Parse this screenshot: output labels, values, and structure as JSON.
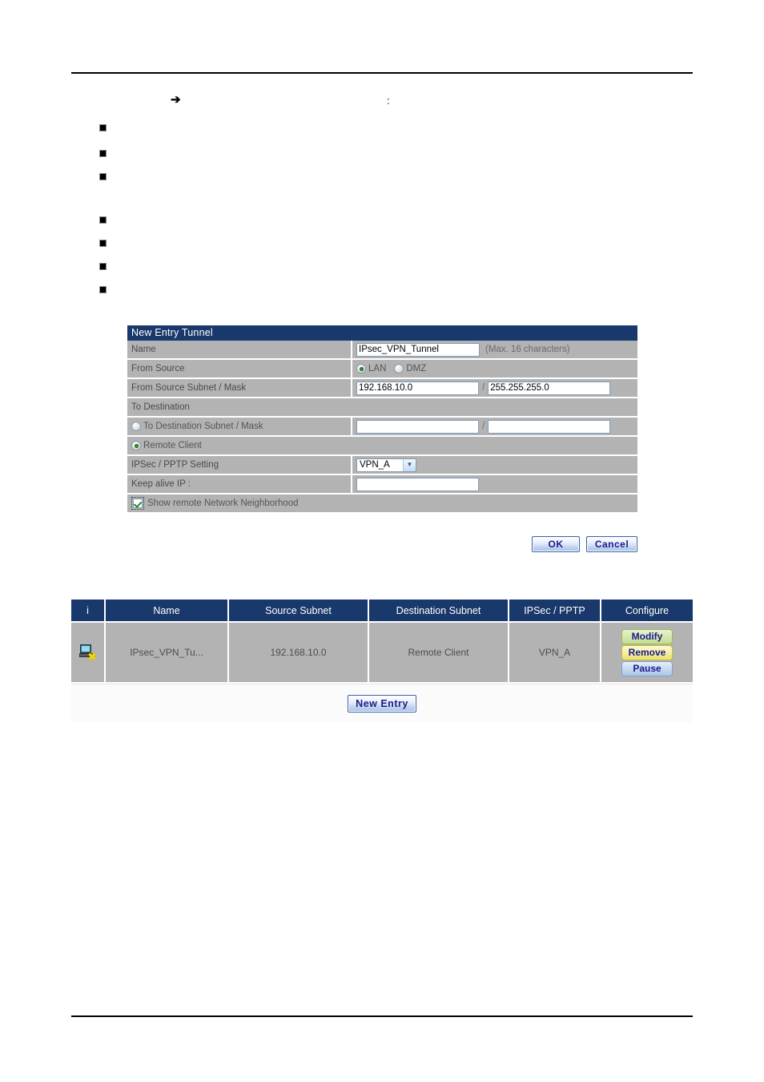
{
  "intro": {
    "arrow_marker": "➔",
    "colon_marker": ":",
    "bullets": [
      "",
      "",
      "",
      "",
      "",
      "",
      ""
    ]
  },
  "form": {
    "title": "New Entry Tunnel",
    "rows": {
      "name_label": "Name",
      "name_value": "IPsec_VPN_Tunnel",
      "name_hint": "(Max. 16 characters)",
      "from_source_label": "From Source",
      "from_source_options": [
        "LAN",
        "DMZ"
      ],
      "from_source_selected": "LAN",
      "from_subnet_label": "From Source Subnet / Mask",
      "from_subnet_value": "192.168.10.0",
      "from_mask_value": "255.255.255.0",
      "to_destination_label": "To Destination",
      "to_dest_subnet_label": "To Destination Subnet / Mask",
      "to_dest_subnet_value": "",
      "to_dest_mask_value": "",
      "remote_client_label": "Remote Client",
      "destination_selected": "Remote Client",
      "ipsec_pptp_label": "IPSec / PPTP Setting",
      "ipsec_pptp_value": "VPN_A",
      "keep_alive_label": "Keep alive IP :",
      "keep_alive_value": "",
      "show_neighborhood_label": "Show remote Network Neighborhood",
      "show_neighborhood_checked": true,
      "slash": "/"
    },
    "buttons": {
      "ok": "OK",
      "cancel": "Cancel"
    }
  },
  "table": {
    "headers": [
      "i",
      "Name",
      "Source Subnet",
      "Destination Subnet",
      "IPSec / PPTP",
      "Configure"
    ],
    "rows": [
      {
        "status_icon": "computer-disconnected-icon",
        "name": "IPsec_VPN_Tu...",
        "source_subnet": "192.168.10.0",
        "destination_subnet": "Remote Client",
        "ipsec_pptp": "VPN_A",
        "configure": [
          "Modify",
          "Remove",
          "Pause"
        ]
      }
    ],
    "new_entry_button": "New  Entry"
  },
  "colors": {
    "header_navy": "#19386b",
    "row_gray": "#b3b3b3",
    "input_border": "#7f9db9",
    "button_text": "#1a1a8c",
    "modify_green": "#c3dc92",
    "remove_yellow": "#e9e071",
    "pause_blue": "#a9c6e8",
    "radio_green": "#2c9a2c"
  }
}
